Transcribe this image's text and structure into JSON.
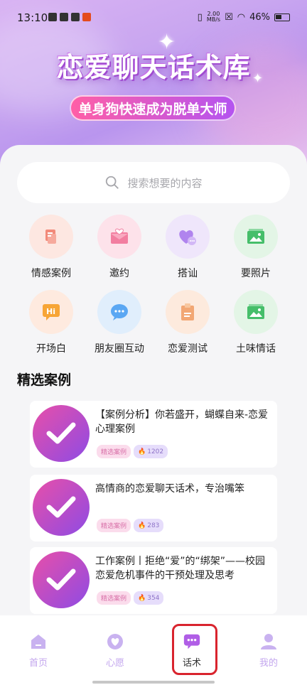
{
  "status": {
    "time": "13:10",
    "net_speed_top": "2.00",
    "net_speed_bottom": "MB/s",
    "battery": "46%"
  },
  "hero": {
    "title": "恋爱聊天话术库",
    "subtitle": "单身狗快速成为脱单大师"
  },
  "search": {
    "placeholder": "搜索想要的内容"
  },
  "grid": [
    {
      "label": "情感案例",
      "icon": "doc-icon",
      "bg": "#fde7e1",
      "color": "#f28a7a"
    },
    {
      "label": "邀约",
      "icon": "envelope-heart-icon",
      "bg": "#fde2ea",
      "color": "#f27ea0"
    },
    {
      "label": "搭讪",
      "icon": "heart-chat-icon",
      "bg": "#efe6fb",
      "color": "#b084ee"
    },
    {
      "label": "要照片",
      "icon": "photo-icon",
      "bg": "#e3f5e6",
      "color": "#46be6a"
    },
    {
      "label": "开场白",
      "icon": "hi-icon",
      "bg": "#feeadf",
      "color": "#f7a536"
    },
    {
      "label": "朋友圈互动",
      "icon": "chat-bubble-icon",
      "bg": "#e0eefc",
      "color": "#5aa7f3"
    },
    {
      "label": "恋爱测试",
      "icon": "clipboard-icon",
      "bg": "#fdeadd",
      "color": "#f2a774"
    },
    {
      "label": "土味情话",
      "icon": "photo-icon",
      "bg": "#e3f5e6",
      "color": "#46be6a"
    }
  ],
  "section": {
    "title": "精选案例"
  },
  "cards": [
    {
      "title": "【案例分析】你若盛开，蝴蝶自来-恋爱心理案例",
      "tag": "精选案例",
      "count": "1202"
    },
    {
      "title": "高情商的恋爱聊天话术，专治嘴笨",
      "tag": "精选案例",
      "count": "283"
    },
    {
      "title": "工作案例丨拒绝“爱”的“绑架”——校园恋爱危机事件的干预处理及思考",
      "tag": "精选案例",
      "count": "354"
    }
  ],
  "tabs": [
    {
      "label": "首页",
      "icon": "home-icon"
    },
    {
      "label": "心愿",
      "icon": "heart-icon"
    },
    {
      "label": "话术",
      "icon": "chat-icon"
    },
    {
      "label": "我的",
      "icon": "profile-icon"
    }
  ]
}
